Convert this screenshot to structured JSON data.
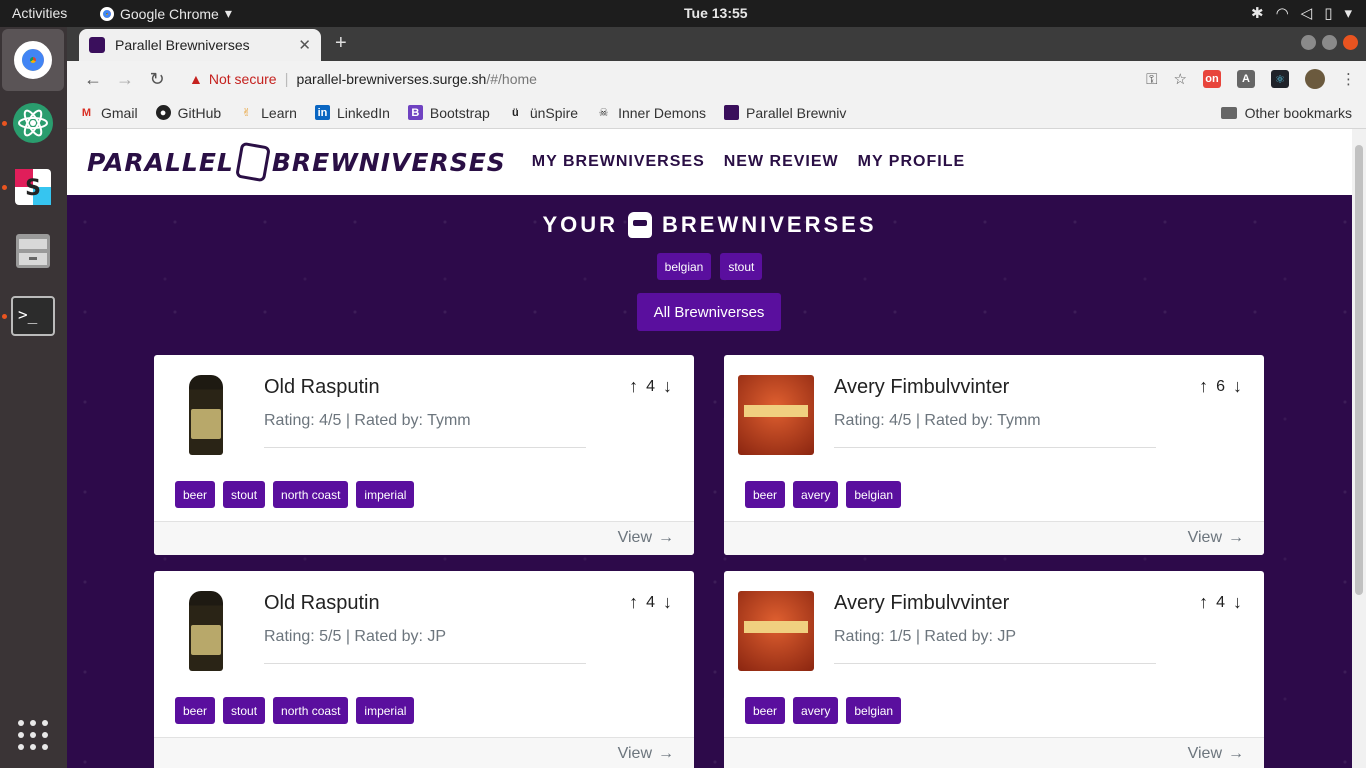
{
  "os": {
    "activities": "Activities",
    "app_menu": "Google Chrome",
    "clock": "Tue 13:55"
  },
  "browser": {
    "tab_title": "Parallel Brewniverses",
    "security": "Not secure",
    "url_host": "parallel-brewniverses.surge.sh",
    "url_path": "/#/home",
    "bookmarks": [
      "Gmail",
      "GitHub",
      "Learn",
      "LinkedIn",
      "Bootstrap",
      "ünSpire",
      "Inner Demons",
      "Parallel Brewniv"
    ],
    "other_bookmarks": "Other bookmarks"
  },
  "site": {
    "logo_left": "PARALLEL",
    "logo_right": "BREWNIVERSES",
    "nav": [
      "MY BREWNIVERSES",
      "NEW REVIEW",
      "MY PROFILE"
    ],
    "hero_left": "YOUR",
    "hero_right": "BREWNIVERSES",
    "filter_tags": [
      "belgian",
      "stout"
    ],
    "all_button": "All Brewniverses",
    "view_label": "View"
  },
  "cards": [
    {
      "title": "Old Rasputin",
      "subtitle": "Rating: 4/5 | Rated by: Tymm",
      "votes": "4",
      "image": "bottle",
      "tags": [
        "beer",
        "stout",
        "north coast",
        "imperial"
      ]
    },
    {
      "title": "Avery Fimbulvvinter",
      "subtitle": "Rating: 4/5 | Rated by: Tymm",
      "votes": "6",
      "image": "can",
      "tags": [
        "beer",
        "avery",
        "belgian"
      ]
    },
    {
      "title": "Old Rasputin",
      "subtitle": "Rating: 5/5 | Rated by: JP",
      "votes": "4",
      "image": "bottle",
      "tags": [
        "beer",
        "stout",
        "north coast",
        "imperial"
      ]
    },
    {
      "title": "Avery Fimbulvvinter",
      "subtitle": "Rating: 1/5 | Rated by: JP",
      "votes": "4",
      "image": "can",
      "tags": [
        "beer",
        "avery",
        "belgian"
      ]
    }
  ],
  "colors": {
    "brand_dark": "#2a0f45",
    "hero_bg": "#2d0a4a",
    "tag_bg": "#5a0f9e",
    "ubuntu_orange": "#e95420"
  }
}
